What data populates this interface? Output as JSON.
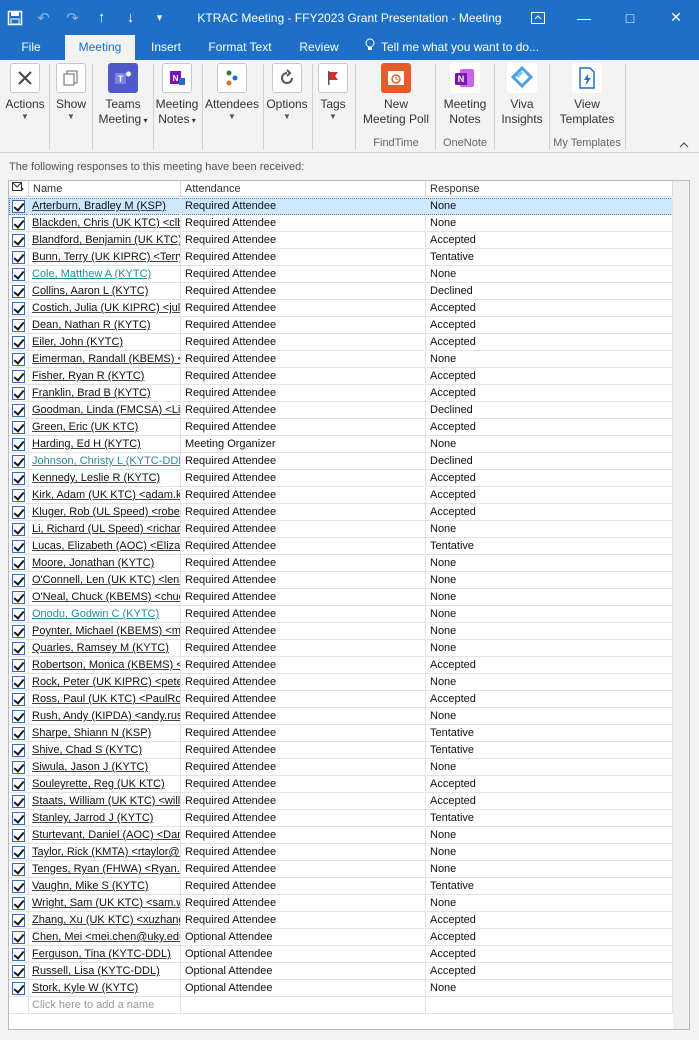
{
  "window": {
    "title": "KTRAC Meeting - FFY2023 Grant Presentation - Meeting",
    "controls": {
      "restore": "⧉",
      "minimize": "—",
      "maximize": "□",
      "close": "✕"
    }
  },
  "qat": {
    "save": "💾",
    "undo": "↶",
    "redo": "↷",
    "up": "↑",
    "down": "↓",
    "more": "▾"
  },
  "tabs": {
    "file": "File",
    "meeting": "Meeting",
    "insert": "Insert",
    "format_text": "Format Text",
    "review": "Review",
    "tell_me": "Tell me what you want to do..."
  },
  "ribbon": {
    "actions": "Actions",
    "show": "Show",
    "teams_meeting": [
      "Teams",
      "Meeting"
    ],
    "meeting_notes_small": [
      "Meeting",
      "Notes"
    ],
    "attendees": "Attendees",
    "options": "Options",
    "tags": "Tags",
    "new_meeting_poll": [
      "New",
      "Meeting Poll"
    ],
    "onenote_meeting_notes": [
      "Meeting",
      "Notes"
    ],
    "viva_insights": [
      "Viva",
      "Insights"
    ],
    "view_templates": [
      "View",
      "Templates"
    ],
    "groups": {
      "findtime": "FindTime",
      "onenote": "OneNote",
      "my_templates": "My Templates"
    }
  },
  "content": {
    "note": "The following responses to this meeting have been received:",
    "columns": {
      "name": "Name",
      "attendance": "Attendance",
      "response": "Response"
    },
    "add_placeholder": "Click here to add a name"
  },
  "rows": [
    {
      "name": "Arterburn, Bradley M (KSP)",
      "attendance": "Required Attendee",
      "response": "None"
    },
    {
      "name": "Blackden, Chris (UK KTC) <clbla",
      "attendance": "Required Attendee",
      "response": "None"
    },
    {
      "name": "Blandford, Benjamin (UK KTC) <",
      "attendance": "Required Attendee",
      "response": "Accepted"
    },
    {
      "name": "Bunn, Terry (UK KIPRC) <Terry",
      "attendance": "Required Attendee",
      "response": "Tentative"
    },
    {
      "name": "Cole, Matthew A (KYTC)",
      "attendance": "Required Attendee",
      "response": "None"
    },
    {
      "name": "Collins, Aaron L (KYTC)",
      "attendance": "Required Attendee",
      "response": "Declined"
    },
    {
      "name": "Costich, Julia (UK KIPRC) <julia",
      "attendance": "Required Attendee",
      "response": "Accepted"
    },
    {
      "name": "Dean, Nathan R (KYTC)",
      "attendance": "Required Attendee",
      "response": "Accepted"
    },
    {
      "name": "Eiler, John (KYTC)",
      "attendance": "Required Attendee",
      "response": "Accepted"
    },
    {
      "name": "Eimerman, Randall (KBEMS) <ra",
      "attendance": "Required Attendee",
      "response": "None"
    },
    {
      "name": "Fisher, Ryan R (KYTC)",
      "attendance": "Required Attendee",
      "response": "Accepted"
    },
    {
      "name": "Franklin, Brad B (KYTC)",
      "attendance": "Required Attendee",
      "response": "Accepted"
    },
    {
      "name": "Goodman, Linda (FMCSA) <Linc",
      "attendance": "Required Attendee",
      "response": "Declined"
    },
    {
      "name": "Green, Eric (UK KTC)",
      "attendance": "Required Attendee",
      "response": "Accepted"
    },
    {
      "name": "Harding, Ed H (KYTC)",
      "attendance": "Meeting Organizer",
      "response": "None"
    },
    {
      "name": "Johnson, Christy L (KYTC-DDL)",
      "attendance": "Required Attendee",
      "response": "Declined"
    },
    {
      "name": "Kennedy, Leslie R (KYTC)",
      "attendance": "Required Attendee",
      "response": "Accepted"
    },
    {
      "name": "Kirk, Adam (UK KTC) <adam.kirl",
      "attendance": "Required Attendee",
      "response": "Accepted"
    },
    {
      "name": "Kluger, Rob (UL Speed) <rober",
      "attendance": "Required Attendee",
      "response": "Accepted"
    },
    {
      "name": "Li, Richard (UL Speed) <richard",
      "attendance": "Required Attendee",
      "response": "None"
    },
    {
      "name": "Lucas, Elizabeth (AOC) <Elizabe",
      "attendance": "Required Attendee",
      "response": "Tentative"
    },
    {
      "name": "Moore, Jonathan (KYTC)",
      "attendance": "Required Attendee",
      "response": "None"
    },
    {
      "name": "O'Connell, Len (UK KTC) <lenah",
      "attendance": "Required Attendee",
      "response": "None"
    },
    {
      "name": "O'Neal, Chuck (KBEMS) <chuck.",
      "attendance": "Required Attendee",
      "response": "None"
    },
    {
      "name": "Onodu, Godwin C (KYTC)",
      "attendance": "Required Attendee",
      "response": "None"
    },
    {
      "name": "Poynter, Michael (KBEMS) <mic",
      "attendance": "Required Attendee",
      "response": "None"
    },
    {
      "name": "Quarles, Ramsey M (KYTC)",
      "attendance": "Required Attendee",
      "response": "None"
    },
    {
      "name": "Robertson, Monica (KBEMS) <m",
      "attendance": "Required Attendee",
      "response": "Accepted"
    },
    {
      "name": "Rock, Peter (UK KIPRC) <peter",
      "attendance": "Required Attendee",
      "response": "None"
    },
    {
      "name": "Ross, Paul (UK KTC) <PaulRoss",
      "attendance": "Required Attendee",
      "response": "Accepted"
    },
    {
      "name": "Rush, Andy (KIPDA) <andy.rus",
      "attendance": "Required Attendee",
      "response": "None"
    },
    {
      "name": "Sharpe, Shiann N (KSP)",
      "attendance": "Required Attendee",
      "response": "Tentative"
    },
    {
      "name": "Shive, Chad S (KYTC)",
      "attendance": "Required Attendee",
      "response": "Tentative"
    },
    {
      "name": "Siwula, Jason J (KYTC)",
      "attendance": "Required Attendee",
      "response": "None"
    },
    {
      "name": "Souleyrette, Reg (UK KTC)",
      "attendance": "Required Attendee",
      "response": "Accepted"
    },
    {
      "name": "Staats, William (UK KTC) <willian",
      "attendance": "Required Attendee",
      "response": "Accepted"
    },
    {
      "name": "Stanley, Jarrod J (KYTC)",
      "attendance": "Required Attendee",
      "response": "Tentative"
    },
    {
      "name": "Sturtevant, Daniel (AOC) <Dan",
      "attendance": "Required Attendee",
      "response": "None"
    },
    {
      "name": "Taylor, Rick (KMTA) <rtaylor@k",
      "attendance": "Required Attendee",
      "response": "None"
    },
    {
      "name": "Tenges, Ryan (FHWA) <Ryan.T",
      "attendance": "Required Attendee",
      "response": "None"
    },
    {
      "name": "Vaughn, Mike S (KYTC)",
      "attendance": "Required Attendee",
      "response": "Tentative"
    },
    {
      "name": "Wright, Sam (UK KTC) <sam.wr",
      "attendance": "Required Attendee",
      "response": "None"
    },
    {
      "name": "Zhang, Xu (UK KTC) <xuzhang",
      "attendance": "Required Attendee",
      "response": "Accepted"
    },
    {
      "name": "Chen, Mei <mei.chen@uky.edu",
      "attendance": "Optional Attendee",
      "response": "Accepted"
    },
    {
      "name": "Ferguson, Tina (KYTC-DDL)",
      "attendance": "Optional Attendee",
      "response": "Accepted"
    },
    {
      "name": "Russell, Lisa (KYTC-DDL)",
      "attendance": "Optional Attendee",
      "response": "Accepted"
    },
    {
      "name": "Stork, Kyle W (KYTC)",
      "attendance": "Optional Attendee",
      "response": "None"
    }
  ],
  "teal_name_rows": [
    4,
    15,
    24
  ],
  "colors": {
    "titlebar": "#1e6fc6",
    "ribbon": "#f3f3f3",
    "selection": "#cde8ff",
    "teal_link": "#2e8b9a"
  }
}
